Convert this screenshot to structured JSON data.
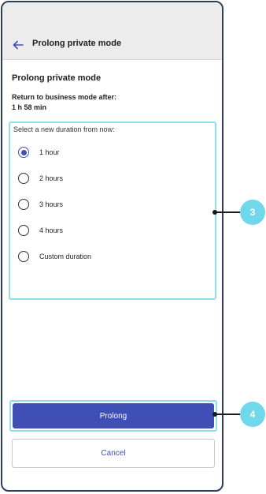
{
  "header": {
    "back_icon": "arrow-left-icon",
    "title": "Prolong private mode"
  },
  "content": {
    "section_title": "Prolong private mode",
    "return_label": "Return to business mode after:",
    "return_value": "1 h 58 min",
    "duration_prompt": "Select a new duration from now:",
    "options": [
      {
        "label": "1 hour",
        "selected": true
      },
      {
        "label": "2 hours",
        "selected": false
      },
      {
        "label": "3 hours",
        "selected": false
      },
      {
        "label": "4 hours",
        "selected": false
      },
      {
        "label": "Custom duration",
        "selected": false
      }
    ]
  },
  "actions": {
    "prolong_label": "Prolong",
    "cancel_label": "Cancel"
  },
  "callouts": {
    "duration_box_number": "3",
    "prolong_button_number": "4"
  },
  "colors": {
    "primary": "#3f4fb6",
    "highlight": "#8fe0ee",
    "callout": "#6fd8ea",
    "header_bg": "#ececec"
  }
}
